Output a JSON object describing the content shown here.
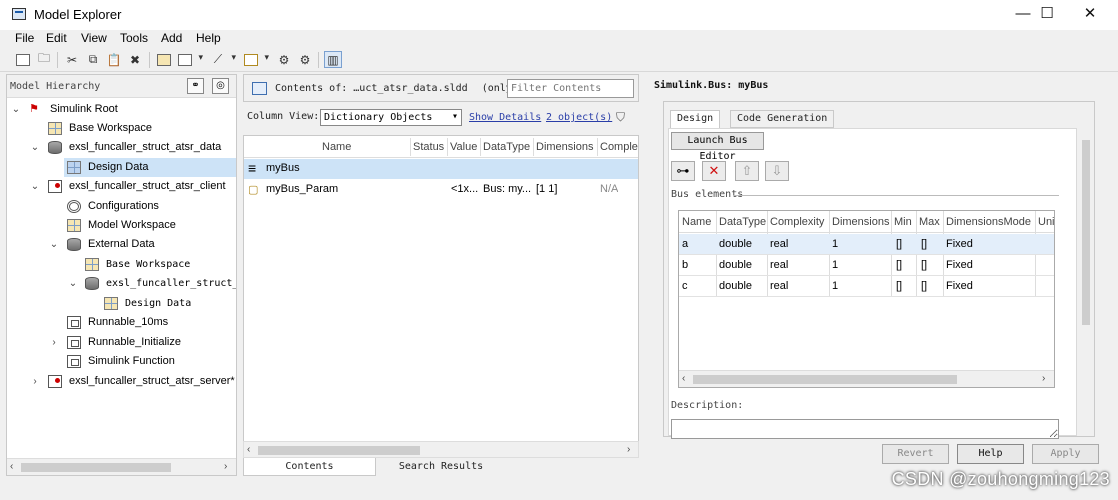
{
  "window": {
    "title": "Model Explorer",
    "minimize_glyph": "—",
    "maximize_glyph": "☐",
    "close_glyph": "✕"
  },
  "menu": [
    "File",
    "Edit",
    "View",
    "Tools",
    "Add",
    "Help"
  ],
  "hierarchy": {
    "label": "Model Hierarchy",
    "items": [
      {
        "label": "Simulink Root",
        "expander": "⌄"
      },
      {
        "label": "Base Workspace",
        "expander": ""
      },
      {
        "label": "exsl_funcaller_struct_atsr_data",
        "expander": "⌄"
      },
      {
        "label": "Design Data",
        "expander": ""
      },
      {
        "label": "exsl_funcaller_struct_atsr_client",
        "expander": "⌄"
      },
      {
        "label": "Configurations",
        "expander": ""
      },
      {
        "label": "Model Workspace",
        "expander": ""
      },
      {
        "label": "External Data",
        "expander": "⌄"
      },
      {
        "label": "Base Workspace",
        "expander": ""
      },
      {
        "label": "exsl_funcaller_struct_atsr_d",
        "expander": "⌄"
      },
      {
        "label": "Design Data",
        "expander": ""
      },
      {
        "label": "Runnable_10ms",
        "expander": ""
      },
      {
        "label": "Runnable_Initialize",
        "expander": "›"
      },
      {
        "label": "Simulink Function",
        "expander": ""
      },
      {
        "label": "exsl_funcaller_struct_atsr_server*",
        "expander": "›"
      }
    ]
  },
  "contents": {
    "prefix": "Contents of:",
    "source": "…uct_atsr_data.sldd",
    "scope": "(only)",
    "filter_placeholder": "Filter Contents",
    "column_view_label": "Column View:",
    "column_view_value": "Dictionary Objects",
    "show_details": "Show Details",
    "object_count": "2 object(s)",
    "columns": [
      "Name",
      "Status",
      "Value",
      "DataType",
      "Dimensions",
      "Complexity"
    ],
    "rows": [
      {
        "icon": "≡",
        "name": "myBus",
        "status": "",
        "value": "",
        "datatype": "",
        "dimensions": "",
        "complexity": ""
      },
      {
        "icon": "▢",
        "name": "myBus_Param",
        "status": "",
        "value": "<1x...",
        "datatype": "Bus: my...",
        "dimensions": "[1 1]",
        "complexity": "N/A"
      }
    ],
    "tabs": [
      "Contents",
      "Search Results"
    ]
  },
  "inspector": {
    "title": "Simulink.Bus: myBus",
    "tabs": [
      "Design",
      "Code Generation"
    ],
    "launch_button": "Launch Bus Editor",
    "bus_elements_label": "Bus elements",
    "columns": [
      "Name",
      "DataType",
      "Complexity",
      "Dimensions",
      "Min",
      "Max",
      "DimensionsMode",
      "Unit"
    ],
    "rows": [
      {
        "name": "a",
        "datatype": "double",
        "complexity": "real",
        "dimensions": "1",
        "min": "[]",
        "max": "[]",
        "mode": "Fixed"
      },
      {
        "name": "b",
        "datatype": "double",
        "complexity": "real",
        "dimensions": "1",
        "min": "[]",
        "max": "[]",
        "mode": "Fixed"
      },
      {
        "name": "c",
        "datatype": "double",
        "complexity": "real",
        "dimensions": "1",
        "min": "[]",
        "max": "[]",
        "mode": "Fixed"
      }
    ],
    "description_label": "Description:",
    "buttons": {
      "revert": "Revert",
      "help": "Help",
      "apply": "Apply"
    }
  },
  "watermark": "CSDN @zouhongming123",
  "colors": {
    "selection": "#cde3f7",
    "link": "#2a3ea8",
    "delete_red": "#d01010"
  }
}
